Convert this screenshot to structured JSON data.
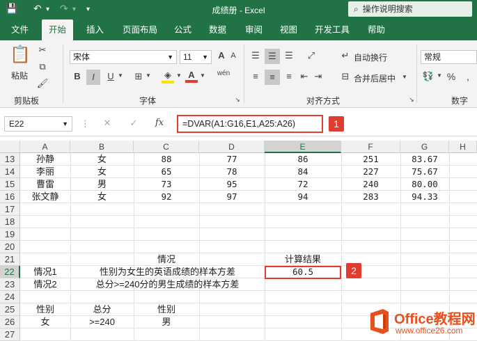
{
  "title_bar": {
    "document_title": "成绩册 - Excel",
    "tell_me": "操作说明搜索"
  },
  "tabs": [
    "文件",
    "开始",
    "插入",
    "页面布局",
    "公式",
    "数据",
    "审阅",
    "视图",
    "开发工具",
    "帮助"
  ],
  "active_tab": "开始",
  "ribbon": {
    "paste_label": "粘贴",
    "clipboard_label": "剪贴板",
    "font_name": "宋体",
    "font_size": "11",
    "font_label": "字体",
    "wrap_text": "自动换行",
    "merge_center": "合并后居中",
    "alignment_label": "对齐方式",
    "number_format": "常规",
    "number_label": "数字",
    "bold": "B",
    "italic": "I",
    "underline": "U",
    "font_grow": "A",
    "font_shrink": "A",
    "percent": "%",
    "comma": ","
  },
  "formula_bar": {
    "name_box": "E22",
    "fx": "fx",
    "formula": "=DVAR(A1:G16,E1,A25:A26)"
  },
  "badges": [
    "1",
    "2"
  ],
  "columns": [
    "A",
    "B",
    "C",
    "D",
    "E",
    "F",
    "G",
    "H"
  ],
  "rows": [
    "13",
    "14",
    "15",
    "16",
    "17",
    "18",
    "19",
    "20",
    "21",
    "22",
    "23",
    "24",
    "25",
    "26",
    "27"
  ],
  "cells": {
    "r13": [
      "孙静",
      "女",
      "88",
      "77",
      "86",
      "251",
      "83.67"
    ],
    "r14": [
      "李丽",
      "女",
      "65",
      "78",
      "84",
      "227",
      "75.67"
    ],
    "r15": [
      "曹雷",
      "男",
      "73",
      "95",
      "72",
      "240",
      "80.00"
    ],
    "r16": [
      "张文静",
      "女",
      "92",
      "97",
      "94",
      "283",
      "94.33"
    ],
    "c21_situation": "情况",
    "e21_result": "计算结果",
    "a22": "情况1",
    "b22": "性别为女生的英语成绩的样本方差",
    "e22": "60.5",
    "a23": "情况2",
    "b23": "总分>=240分的男生成绩的样本方差",
    "a25": "性别",
    "b25": "总分",
    "c25": "性别",
    "a26": "女",
    "b26": ">=240",
    "c26": "男"
  },
  "watermark": {
    "brand": "Office教程网",
    "url": "www.office26.com"
  }
}
